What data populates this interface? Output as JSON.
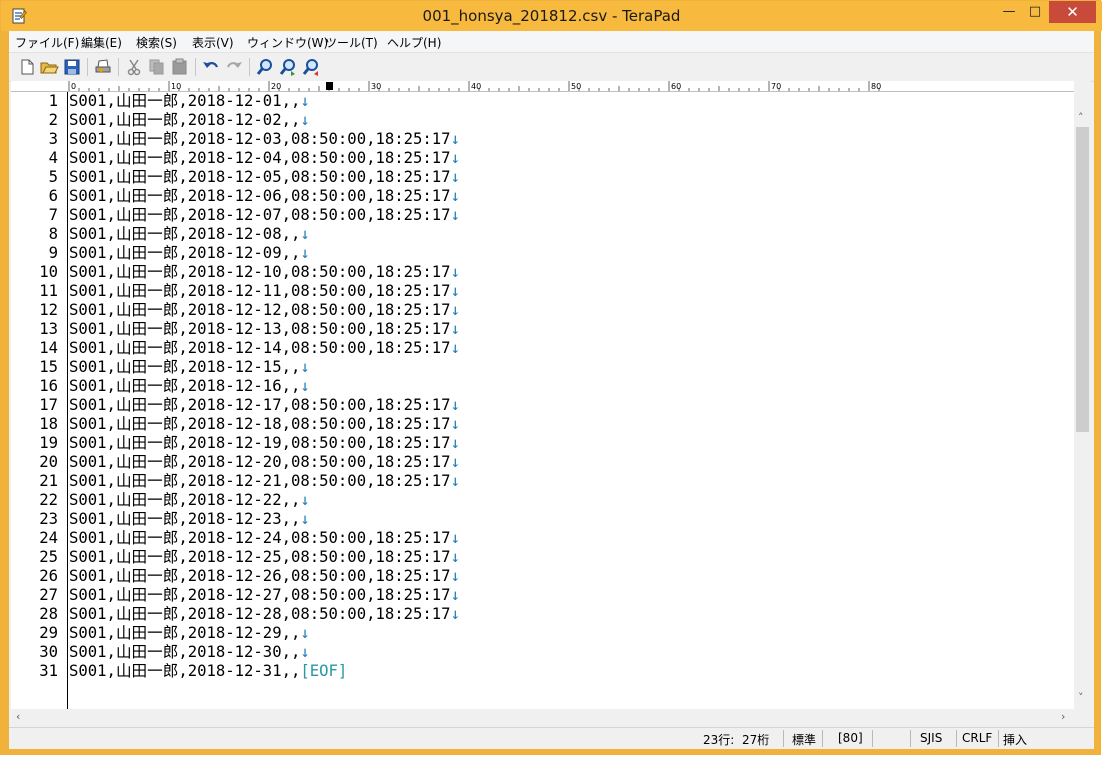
{
  "window": {
    "title": "001_honsya_201812.csv - TeraPad",
    "controls": {
      "minimize": "—",
      "maximize": "□",
      "close": "✕"
    }
  },
  "menu": [
    "ファイル(F)",
    "編集(E)",
    "検索(S)",
    "表示(V)",
    "ウィンドウ(W)",
    "ツール(T)",
    "ヘルプ(H)"
  ],
  "toolbar": {
    "buttons": [
      "new-file-icon",
      "open-folder-icon",
      "save-icon",
      "print-icon",
      "cut-icon",
      "copy-icon",
      "paste-icon",
      "undo-icon",
      "redo-icon",
      "find-icon",
      "find-next-icon",
      "find-prev-icon"
    ]
  },
  "ruler": {
    "marks": [
      "0",
      "10",
      "20",
      "30",
      "40",
      "50",
      "60",
      "70",
      "80"
    ]
  },
  "editor": {
    "eol_mark": "↓",
    "eof_mark": "[EOF]",
    "lines": [
      {
        "n": "1",
        "text": "S001,山田一郎,2018-12-01,,"
      },
      {
        "n": "2",
        "text": "S001,山田一郎,2018-12-02,,"
      },
      {
        "n": "3",
        "text": "S001,山田一郎,2018-12-03,08:50:00,18:25:17"
      },
      {
        "n": "4",
        "text": "S001,山田一郎,2018-12-04,08:50:00,18:25:17"
      },
      {
        "n": "5",
        "text": "S001,山田一郎,2018-12-05,08:50:00,18:25:17"
      },
      {
        "n": "6",
        "text": "S001,山田一郎,2018-12-06,08:50:00,18:25:17"
      },
      {
        "n": "7",
        "text": "S001,山田一郎,2018-12-07,08:50:00,18:25:17"
      },
      {
        "n": "8",
        "text": "S001,山田一郎,2018-12-08,,"
      },
      {
        "n": "9",
        "text": "S001,山田一郎,2018-12-09,,"
      },
      {
        "n": "10",
        "text": "S001,山田一郎,2018-12-10,08:50:00,18:25:17"
      },
      {
        "n": "11",
        "text": "S001,山田一郎,2018-12-11,08:50:00,18:25:17"
      },
      {
        "n": "12",
        "text": "S001,山田一郎,2018-12-12,08:50:00,18:25:17"
      },
      {
        "n": "13",
        "text": "S001,山田一郎,2018-12-13,08:50:00,18:25:17"
      },
      {
        "n": "14",
        "text": "S001,山田一郎,2018-12-14,08:50:00,18:25:17"
      },
      {
        "n": "15",
        "text": "S001,山田一郎,2018-12-15,,"
      },
      {
        "n": "16",
        "text": "S001,山田一郎,2018-12-16,,"
      },
      {
        "n": "17",
        "text": "S001,山田一郎,2018-12-17,08:50:00,18:25:17"
      },
      {
        "n": "18",
        "text": "S001,山田一郎,2018-12-18,08:50:00,18:25:17"
      },
      {
        "n": "19",
        "text": "S001,山田一郎,2018-12-19,08:50:00,18:25:17"
      },
      {
        "n": "20",
        "text": "S001,山田一郎,2018-12-20,08:50:00,18:25:17"
      },
      {
        "n": "21",
        "text": "S001,山田一郎,2018-12-21,08:50:00,18:25:17"
      },
      {
        "n": "22",
        "text": "S001,山田一郎,2018-12-22,,"
      },
      {
        "n": "23",
        "text": "S001,山田一郎,2018-12-23,,"
      },
      {
        "n": "24",
        "text": "S001,山田一郎,2018-12-24,08:50:00,18:25:17"
      },
      {
        "n": "25",
        "text": "S001,山田一郎,2018-12-25,08:50:00,18:25:17"
      },
      {
        "n": "26",
        "text": "S001,山田一郎,2018-12-26,08:50:00,18:25:17"
      },
      {
        "n": "27",
        "text": "S001,山田一郎,2018-12-27,08:50:00,18:25:17"
      },
      {
        "n": "28",
        "text": "S001,山田一郎,2018-12-28,08:50:00,18:25:17"
      },
      {
        "n": "29",
        "text": "S001,山田一郎,2018-12-29,,"
      },
      {
        "n": "30",
        "text": "S001,山田一郎,2018-12-30,,"
      },
      {
        "n": "31",
        "text": "S001,山田一郎,2018-12-31,,",
        "eof": true
      }
    ]
  },
  "status": {
    "position": "23行:  27桁",
    "mode": "標準",
    "wrap": "[80]",
    "encoding": "SJIS",
    "newline": "CRLF",
    "insert": "挿入"
  },
  "colors": {
    "titlebar": "#f7b93e",
    "eol": "#1d7bb8",
    "eof": "#2898a6",
    "close": "#c74a3a"
  }
}
